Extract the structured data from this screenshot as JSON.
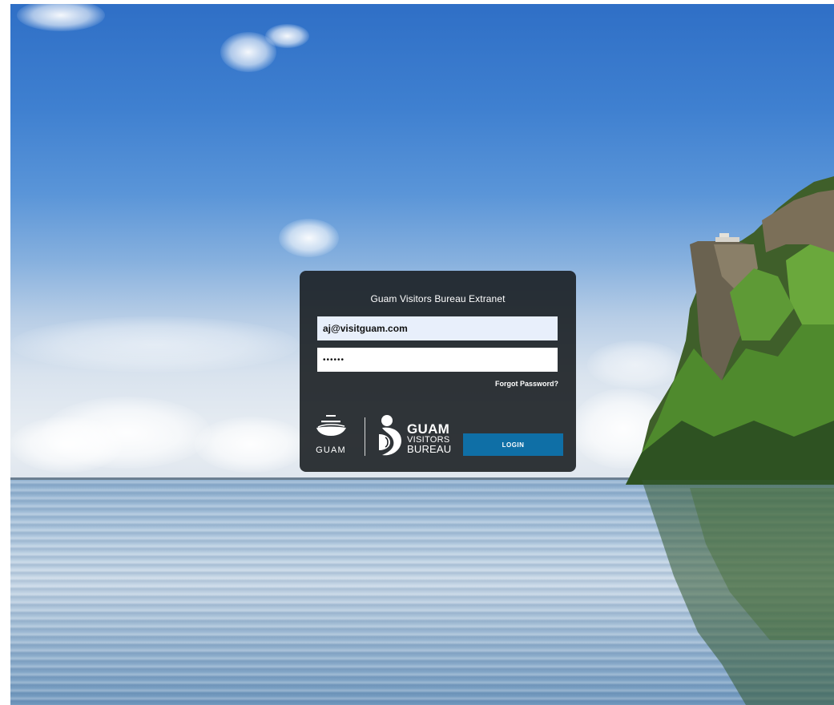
{
  "login": {
    "title": "Guam Visitors Bureau Extranet",
    "email_value": "aj@visitguam.com",
    "password_value": "••••••",
    "forgot_label": "Forgot Password?",
    "login_label": "LOGIN"
  },
  "logos": {
    "guam_text": "GUAM",
    "gvb_line1": "GUAM",
    "gvb_line2": "VISITORS",
    "gvb_line3": "BUREAU"
  },
  "colors": {
    "card_bg": "#161a1e",
    "email_bg": "#e8effb",
    "button_bg": "#0f6fa6",
    "text_white": "#ffffff"
  },
  "icons": {
    "guam_logo": "guam-wave-logo-icon",
    "gvb_logo": "gvb-swirl-logo-icon"
  }
}
